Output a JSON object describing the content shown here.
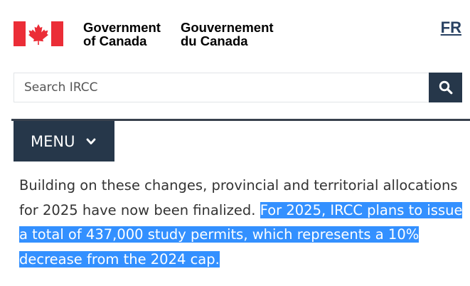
{
  "header": {
    "brand_en_line1": "Government",
    "brand_en_line2": "of Canada",
    "brand_fr_line1": "Gouvernement",
    "brand_fr_line2": "du Canada",
    "language_toggle": "FR"
  },
  "search": {
    "placeholder": "Search IRCC",
    "button_icon": "search-icon"
  },
  "menu": {
    "label": "MENU",
    "icon": "chevron-down-icon"
  },
  "content": {
    "text_plain": "Building on these changes, provincial and territorial allocations for 2025 have now been finalized. ",
    "text_selected": "For 2025, IRCC plans to issue a total of 437,000 study permits, which represents a 10% decrease from the 2024 cap."
  },
  "colors": {
    "flag_red": "#eb2d37",
    "nav_dark": "#26374a",
    "link": "#284162",
    "selection": "#3390ff"
  }
}
